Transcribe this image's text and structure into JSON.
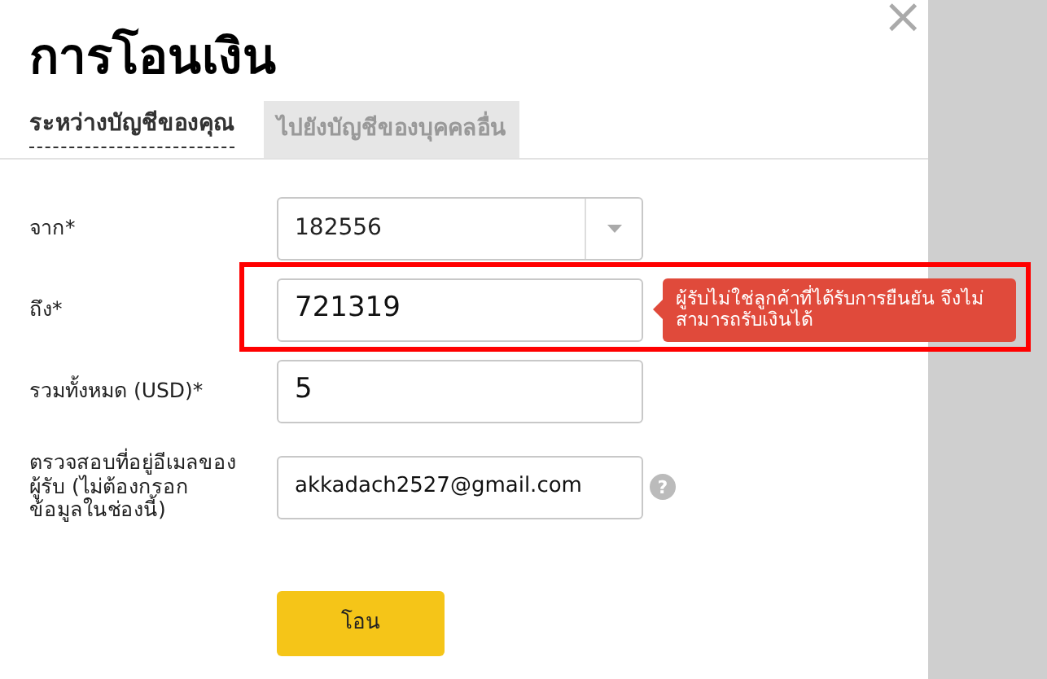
{
  "dialog": {
    "title": "การโอนเงิน",
    "close": "×"
  },
  "tabs": [
    {
      "label": "ระหว่างบัญชีของคุณ",
      "selected": true
    },
    {
      "label": "ไปยังบัญชีของบุคคลอื่น",
      "selected": false
    }
  ],
  "form": {
    "fields": [
      {
        "kind": "select",
        "label": "จาก*",
        "value": "182556"
      },
      {
        "kind": "text",
        "label": "ถึง*",
        "value": "721319",
        "highlighted": true,
        "error": "ผู้รับไม่ใช่ลูกค้าที่ได้รับการยืนยัน จึงไม่สามารถรับเงินได้"
      },
      {
        "kind": "text",
        "label": "รวมทั้งหมด (USD)*",
        "value": "5"
      },
      {
        "kind": "help",
        "label": "ตรวจสอบที่อยู่อีเมลของผู้รับ (ไม่ต้องกรอกข้อมูลในช่องนี้)",
        "value": "akkadach2527@gmail.com",
        "help": "?"
      }
    ],
    "submit": "โอน"
  }
}
